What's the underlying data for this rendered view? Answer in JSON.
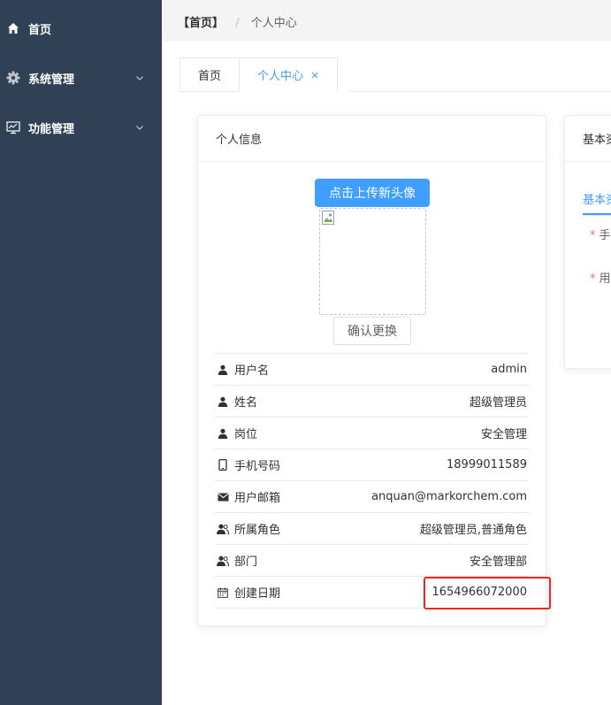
{
  "sidebar": {
    "items": [
      {
        "label": "首页",
        "icon": "home-icon"
      },
      {
        "label": "系统管理",
        "icon": "gear-icon"
      },
      {
        "label": "功能管理",
        "icon": "monitor-icon"
      }
    ]
  },
  "breadcrumb": {
    "home": "【首页】",
    "separator": "/",
    "current": "个人中心"
  },
  "tags": [
    {
      "label": "首页"
    },
    {
      "label": "个人中心",
      "close": "×"
    }
  ],
  "profile_card": {
    "title": "个人信息",
    "upload_label": "点击上传新头像",
    "confirm_label": "确认更换",
    "rows": [
      {
        "label": "用户名",
        "value": "admin",
        "icon": "user-icon"
      },
      {
        "label": "姓名",
        "value": "超级管理员",
        "icon": "user-icon"
      },
      {
        "label": "岗位",
        "value": "安全管理",
        "icon": "user-icon"
      },
      {
        "label": "手机号码",
        "value": "18999011589",
        "icon": "phone-icon"
      },
      {
        "label": "用户邮箱",
        "value": "anquan@markorchem.com",
        "icon": "mail-icon"
      },
      {
        "label": "所属角色",
        "value": "超级管理员,普通角色",
        "icon": "group-icon"
      },
      {
        "label": "部门",
        "value": "安全管理部",
        "icon": "group-icon"
      },
      {
        "label": "创建日期",
        "value": "1654966072000",
        "icon": "calendar-icon"
      }
    ]
  },
  "basic_card": {
    "title": "基本资料",
    "tab": "基本资料",
    "fields": [
      "手机号码",
      "用户邮箱"
    ]
  },
  "colors": {
    "sidebar": "#304156",
    "accent": "#409eff",
    "highlight": "#ff1f1f"
  }
}
